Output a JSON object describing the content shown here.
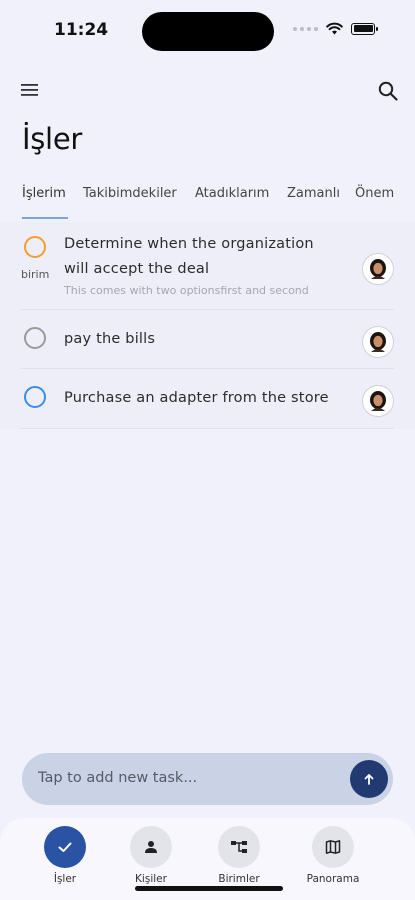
{
  "status_bar": {
    "time": "11:24"
  },
  "header": {
    "title": "İşler",
    "menu_icon": "hamburger-menu-icon",
    "search_icon": "search-icon"
  },
  "tabs": [
    {
      "label": "İşlerim",
      "active": true
    },
    {
      "label": "Takibimdekiler",
      "active": false
    },
    {
      "label": "Atadıklarım",
      "active": false
    },
    {
      "label": "Zamanlı",
      "active": false
    },
    {
      "label": "Önem",
      "active": false
    }
  ],
  "tasks": [
    {
      "title_line1": "Determine when the organization",
      "title_line2": "will accept the deal",
      "note": "This comes with two optionsfirst and second",
      "tag": "birim",
      "circle_color": "#f0a030"
    },
    {
      "title": "pay the bills",
      "circle_color": "#9a9a9a"
    },
    {
      "title": "Purchase an adapter from the store",
      "circle_color": "#3f8ee6"
    }
  ],
  "add_task": {
    "placeholder": "Tap to add new task..."
  },
  "bottom_nav": [
    {
      "label": "İşler",
      "icon": "check-icon",
      "active": true
    },
    {
      "label": "Kişiler",
      "icon": "person-icon",
      "active": false
    },
    {
      "label": "Birimler",
      "icon": "org-chart-icon",
      "active": false
    },
    {
      "label": "Panorama",
      "icon": "map-icon",
      "active": false
    }
  ],
  "colors": {
    "accent": "#2b53a3",
    "send_button": "#213a72",
    "background": "#f1f1fb"
  }
}
